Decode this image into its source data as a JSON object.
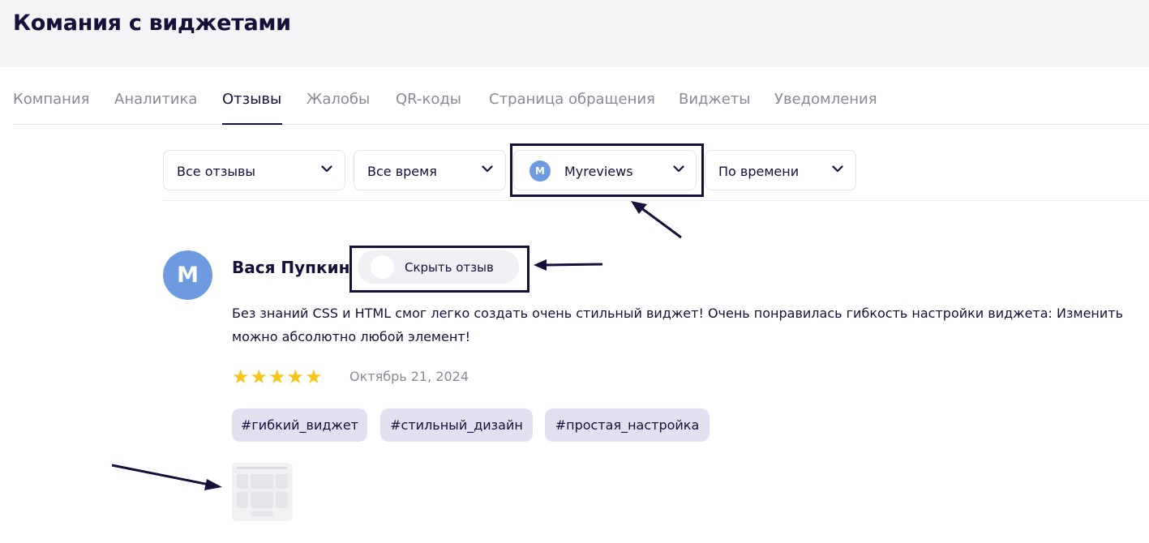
{
  "header": {
    "title": "Комания с виджетами"
  },
  "tabs": [
    {
      "label": "Компания",
      "active": false
    },
    {
      "label": "Аналитика",
      "active": false
    },
    {
      "label": "Отзывы",
      "active": true
    },
    {
      "label": "Жалобы",
      "active": false
    },
    {
      "label": "QR-коды",
      "active": false
    },
    {
      "label": "Страница обращения",
      "active": false
    },
    {
      "label": "Виджеты",
      "active": false
    },
    {
      "label": "Уведомления",
      "active": false
    }
  ],
  "filters": {
    "type": {
      "value": "Все отзывы"
    },
    "period": {
      "value": "Все время"
    },
    "source": {
      "value": "Myreviews",
      "avatar_letter": "M"
    },
    "sort": {
      "value": "По времени"
    }
  },
  "review": {
    "avatar_letter": "M",
    "author": "Вася Пупкин",
    "hide_label": "Скрыть отзыв",
    "text": "Без знаний CSS и HTML смог легко создать очень стильный виджет! Очень понравилась гибкость настройки виджета: Изменить можно абсолютно любой элемент!",
    "rating": 5,
    "stars": [
      "★",
      "★",
      "★",
      "★",
      "★"
    ],
    "date": "Октябрь 21, 2024",
    "tags": [
      "#гибкий_виджет",
      "#стильный_дизайн",
      "#простая_настройка"
    ]
  },
  "colors": {
    "accent_dark": "#14103a",
    "avatar": "#6e9be0",
    "star": "#f5c518",
    "tag_bg": "#e2e0f0",
    "muted_text": "#8a8998"
  },
  "icons": {
    "dropdown": "chevron-down-icon",
    "annotation": "arrow-icon",
    "rating": "star-icon"
  }
}
